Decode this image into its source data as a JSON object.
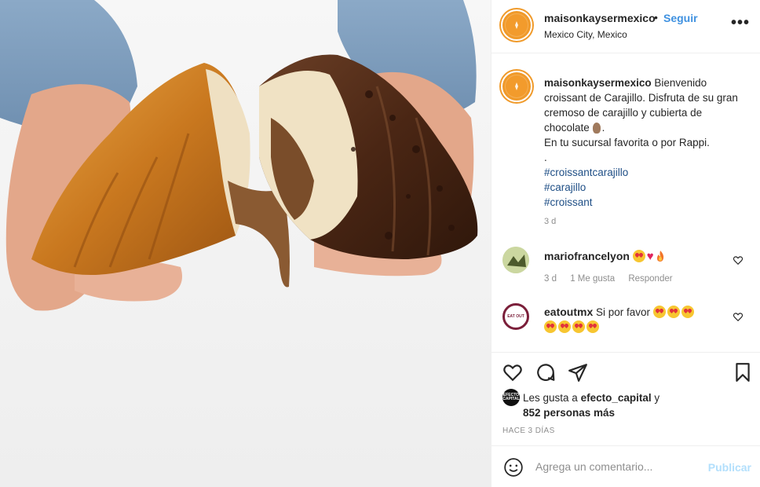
{
  "post": {
    "username": "maisonkaysermexico",
    "follow_label": "Seguir",
    "separator": "•",
    "location": "Mexico City, Mexico",
    "more_label": "•••"
  },
  "caption": {
    "username": "maisonkaysermexico",
    "line1": "Bienvenido croissant de Carajillo. Disfruta de su gran cremoso de carajillo y cubierta de chocolate",
    "line2": "En tu sucursal favorita o por Rappi.",
    "line3": ".",
    "hashtags": [
      "#croissantcarajillo",
      "#carajillo",
      "#croissant"
    ],
    "age": "3 d"
  },
  "comments": [
    {
      "username": "mariofrancelyon",
      "age": "3 d",
      "likes": "1 Me gusta",
      "reply": "Responder"
    },
    {
      "username": "eatoutmx",
      "text": "Si por favor",
      "avatar_text": "EAT OUT"
    }
  ],
  "likes": {
    "prefix": "Les gusta a",
    "user": "efecto_capital",
    "conj": "y",
    "count": "852 personas más",
    "mini_avatar_text": "EFECTO CAPITAL"
  },
  "timestamp": "HACE 3 DÍAS",
  "comment_box": {
    "placeholder": "Agrega un comentario...",
    "publish_label": "Publicar"
  },
  "colors": {
    "brand_orange": "#f09a2a",
    "link_blue": "#3f91e0",
    "hashtag_blue": "#1f4f86",
    "muted": "#8e8e8e"
  }
}
